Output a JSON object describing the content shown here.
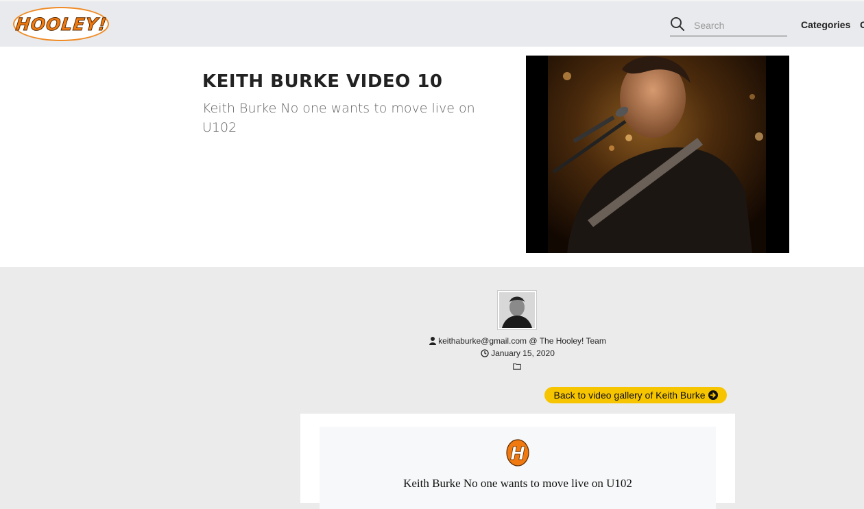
{
  "header": {
    "logo_text": "HOOLEY!",
    "search_placeholder": "Search",
    "nav": {
      "categories": "Categories",
      "clipped_next": "C"
    }
  },
  "hero": {
    "title": "KEITH BURKE VIDEO 10",
    "subtitle": "Keith Burke No one wants to move live on U102"
  },
  "author": {
    "email": "keithaburke@gmail.com",
    "separator": "@",
    "team": "The Hooley! Team",
    "date": "January 15, 2020"
  },
  "back_button": {
    "label": "Back to video gallery of Keith Burke"
  },
  "card": {
    "logo_letter": "H",
    "title": "Keith Burke No one wants to move live on U102"
  },
  "colors": {
    "accent_orange": "#f07a10",
    "button_yellow": "#f7c500",
    "header_bg": "#e8eaed",
    "page_bg": "#ebebeb"
  },
  "icons": [
    "search-icon",
    "user-icon",
    "clock-icon",
    "folder-icon",
    "arrow-circle-right-icon",
    "hooley-h-icon"
  ]
}
